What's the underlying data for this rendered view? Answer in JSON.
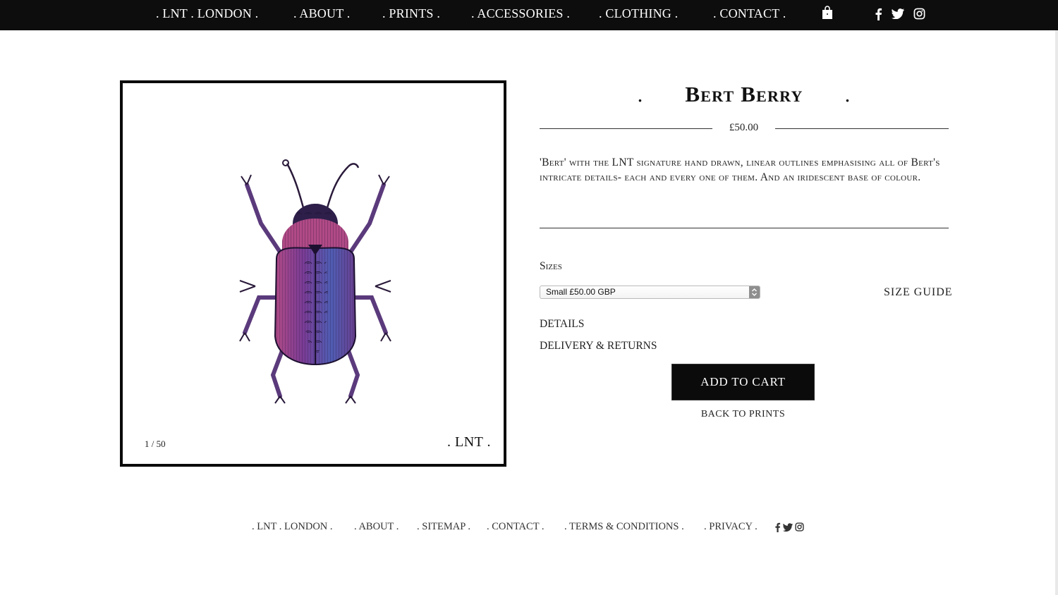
{
  "nav": {
    "items": [
      {
        "label": ". LNT . LONDON ."
      },
      {
        "label": ". ABOUT ."
      },
      {
        "label": ". PRINTS ."
      },
      {
        "label": ". ACCESSORIES ."
      },
      {
        "label": ". CLOTHING ."
      },
      {
        "label": ". CONTACT ."
      }
    ],
    "icons": [
      "shopping-bag-icon",
      "facebook-icon",
      "twitter-icon",
      "instagram-icon"
    ]
  },
  "product": {
    "title": "Bert Berry",
    "title_dot": ".",
    "price": "£50.00",
    "description": "'Bert' with the LNT signature hand drawn, linear outlines emphasising all of Bert's intricate details- each and every one of them. And an iridescent base of colour.",
    "image": {
      "edition": "1 / 50",
      "signature": ". LNT ."
    },
    "sizes_label": "Sizes",
    "size_selected": "Small £50.00 GBP",
    "size_guide": "SIZE GUIDE",
    "details_label": "DETAILS",
    "delivery_label": "DELIVERY & RETURNS",
    "add_to_cart": "ADD TO CART",
    "back_link": "BACK TO PRINTS"
  },
  "footer": {
    "items": [
      {
        "label": ". LNT . LONDON ."
      },
      {
        "label": ". ABOUT ."
      },
      {
        "label": ". SITEMAP ."
      },
      {
        "label": ". CONTACT ."
      },
      {
        "label": ". TERMS & CONDITIONS ."
      },
      {
        "label": ". PRIVACY ."
      }
    ],
    "icons": [
      "facebook-icon",
      "twitter-icon",
      "instagram-icon"
    ]
  },
  "colors": {
    "nav_background": "#0d0d0d",
    "button_background": "#0b0b0b",
    "beetle_purple": "#6a3f8f",
    "beetle_pink": "#b04a86"
  }
}
